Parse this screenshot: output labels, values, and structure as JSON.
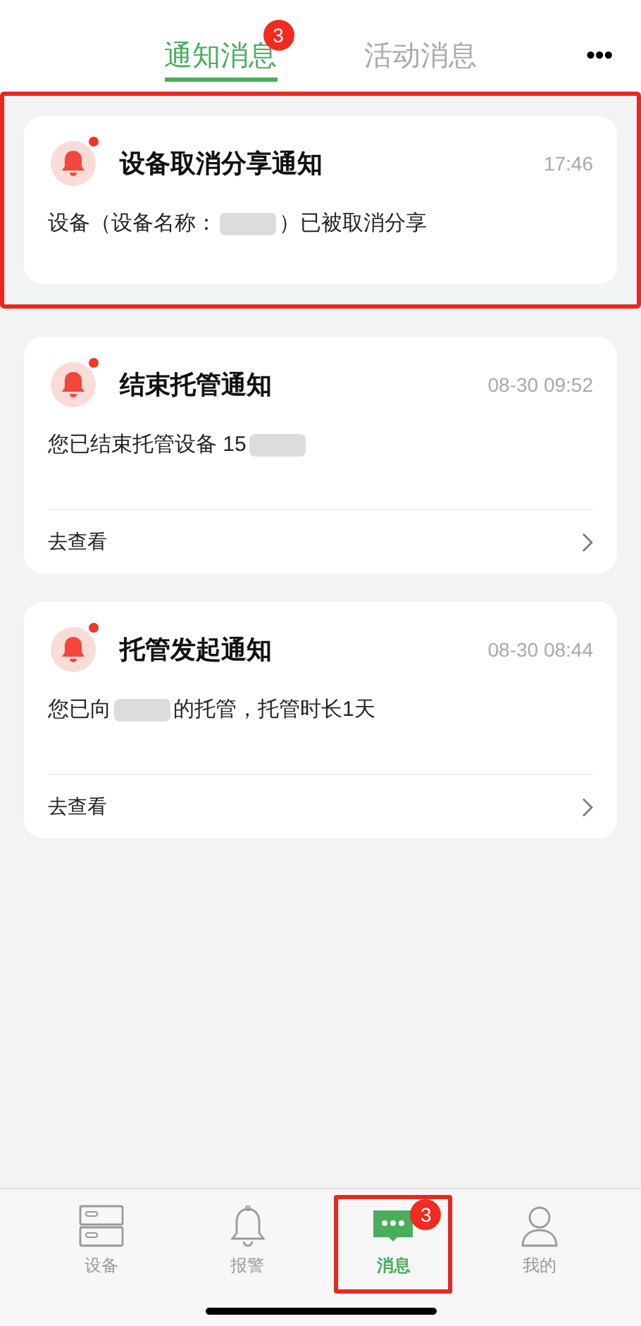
{
  "tabs": [
    {
      "label": "通知消息",
      "selected": true,
      "badge": "3"
    },
    {
      "label": "活动消息",
      "selected": false
    }
  ],
  "more_button": "•••",
  "notifications": [
    {
      "title": "设备取消分享通知",
      "time": "17:46",
      "unread": true,
      "highlighted": true,
      "body": [
        {
          "kind": "text",
          "text": "设备（设备名称："
        },
        {
          "kind": "redacted"
        },
        {
          "kind": "text",
          "text": "）已被取消分享"
        }
      ]
    },
    {
      "title": "结束托管通知",
      "time": "08-30 09:52",
      "unread": true,
      "highlighted": false,
      "body": [
        {
          "kind": "text",
          "text": "您已结束托管设备 15"
        },
        {
          "kind": "redacted"
        }
      ],
      "action": "去查看"
    },
    {
      "title": "托管发起通知",
      "time": "08-30 08:44",
      "unread": true,
      "highlighted": false,
      "body": [
        {
          "kind": "text",
          "text": "您已向"
        },
        {
          "kind": "redacted"
        },
        {
          "kind": "text",
          "text": "的托管，托管时长1天"
        }
      ],
      "action": "去查看"
    }
  ],
  "tab_bar": [
    {
      "label": "设备",
      "kind": "device",
      "selected": false,
      "highlighted": false
    },
    {
      "label": "报警",
      "kind": "alarm",
      "selected": false,
      "highlighted": false
    },
    {
      "label": "消息",
      "kind": "message",
      "selected": true,
      "highlighted": true,
      "badge": "3"
    },
    {
      "label": "我的",
      "kind": "profile",
      "selected": false,
      "highlighted": false
    }
  ]
}
